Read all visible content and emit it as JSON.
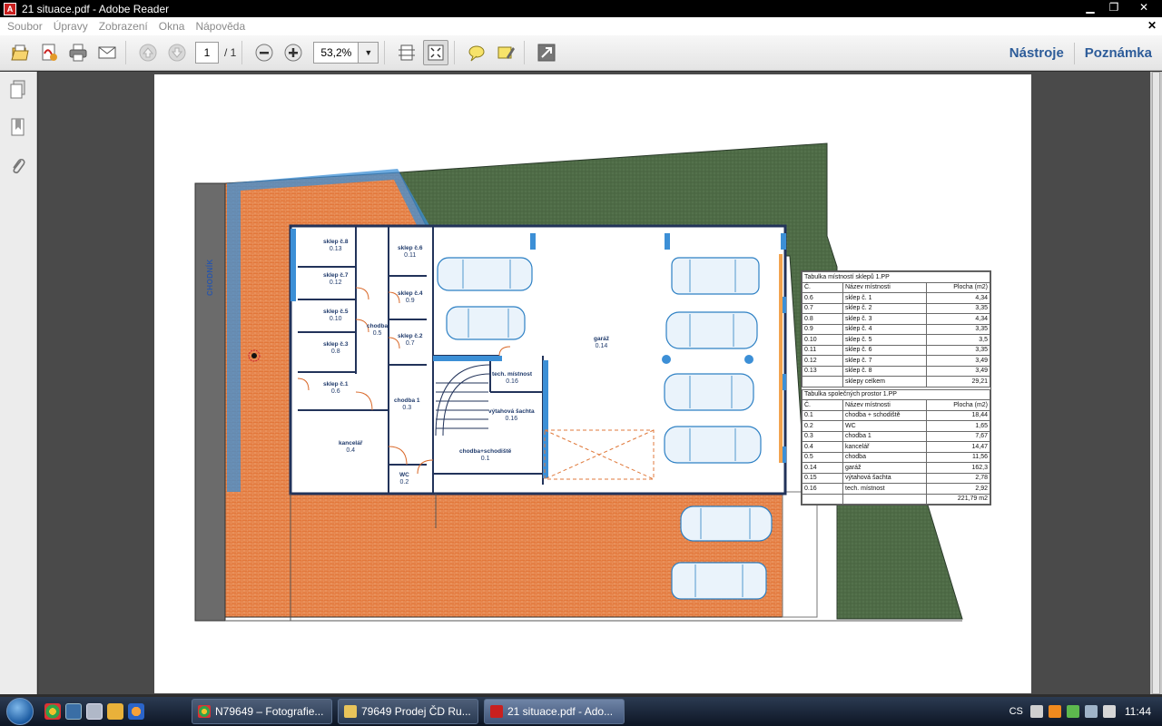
{
  "window": {
    "title": "21 situace.pdf - Adobe Reader",
    "minimize": "▁",
    "maximize": "❐",
    "close": "✕"
  },
  "menu": {
    "items": [
      "Soubor",
      "Úpravy",
      "Zobrazení",
      "Okna",
      "Nápověda"
    ],
    "doc_close": "✕"
  },
  "toolbar": {
    "page_current": "1",
    "page_total": "/ 1",
    "zoom": "53,2%",
    "tools_label": "Nástroje",
    "comment_label": "Poznámka"
  },
  "plan": {
    "side_label": "CHODNÍK",
    "rooms": [
      {
        "name": "sklep č.8",
        "num": "0.13"
      },
      {
        "name": "sklep č.7",
        "num": "0.12"
      },
      {
        "name": "sklep č.5",
        "num": "0.10"
      },
      {
        "name": "sklep č.3",
        "num": "0.8"
      },
      {
        "name": "sklep č.1",
        "num": "0.6"
      },
      {
        "name": "kancelář",
        "num": "0.4"
      },
      {
        "name": "sklep č.6",
        "num": "0.11"
      },
      {
        "name": "sklep č.4",
        "num": "0.9"
      },
      {
        "name": "sklep č.2",
        "num": "0.7"
      },
      {
        "name": "chodba",
        "num": "0.5"
      },
      {
        "name": "chodba 1",
        "num": "0.3"
      },
      {
        "name": "WC",
        "num": "0.2"
      },
      {
        "name": "chodba+schodiště",
        "num": "0.1"
      },
      {
        "name": "tech. místnost",
        "num": "0.16"
      },
      {
        "name": "výtahová šachta",
        "num": "0.16"
      },
      {
        "name": "garáž",
        "num": "0.14"
      }
    ]
  },
  "table_cellars": {
    "caption": "Tabulka místností sklepů 1.PP",
    "headers": [
      "Č.",
      "Název místnosti",
      "Plocha (m2)"
    ],
    "rows": [
      [
        "0.6",
        "sklep č. 1",
        "4,34"
      ],
      [
        "0.7",
        "sklep č. 2",
        "3,35"
      ],
      [
        "0.8",
        "sklep č. 3",
        "4,34"
      ],
      [
        "0.9",
        "sklep č. 4",
        "3,35"
      ],
      [
        "0.10",
        "sklep č. 5",
        "3,5"
      ],
      [
        "0.11",
        "sklep č. 6",
        "3,35"
      ],
      [
        "0.12",
        "sklep č. 7",
        "3,49"
      ],
      [
        "0.13",
        "sklep č. 8",
        "3,49"
      ],
      [
        "",
        "sklepy celkem",
        "29,21"
      ]
    ]
  },
  "table_common": {
    "caption": "Tabulka společných prostor 1.PP",
    "headers": [
      "Č.",
      "Název místnosti",
      "Plocha (m2)"
    ],
    "rows": [
      [
        "0.1",
        "chodba + schodiště",
        "18,44"
      ],
      [
        "0.2",
        "WC",
        "1,65"
      ],
      [
        "0.3",
        "chodba 1",
        "7,67"
      ],
      [
        "0.4",
        "kancelář",
        "14,47"
      ],
      [
        "0.5",
        "chodba",
        "11,56"
      ],
      [
        "0.14",
        "garáž",
        "162,3"
      ],
      [
        "0.15",
        "výtahová šachta",
        "2,78"
      ],
      [
        "0.16",
        "tech. místnost",
        "2,92"
      ],
      [
        "",
        "",
        "221,79 m2"
      ]
    ]
  },
  "taskbar": {
    "items": [
      "N79649 – Fotografie...",
      "79649 Prodej ČD Ru...",
      "21 situace.pdf - Ado..."
    ],
    "lang": "CS",
    "clock": "11:44"
  },
  "colors": {
    "paving": "#e2773a",
    "lawn": "#4e6b46",
    "wall": "#22335a",
    "glass": "#3c8fd6",
    "road": "#6b6b6b"
  }
}
